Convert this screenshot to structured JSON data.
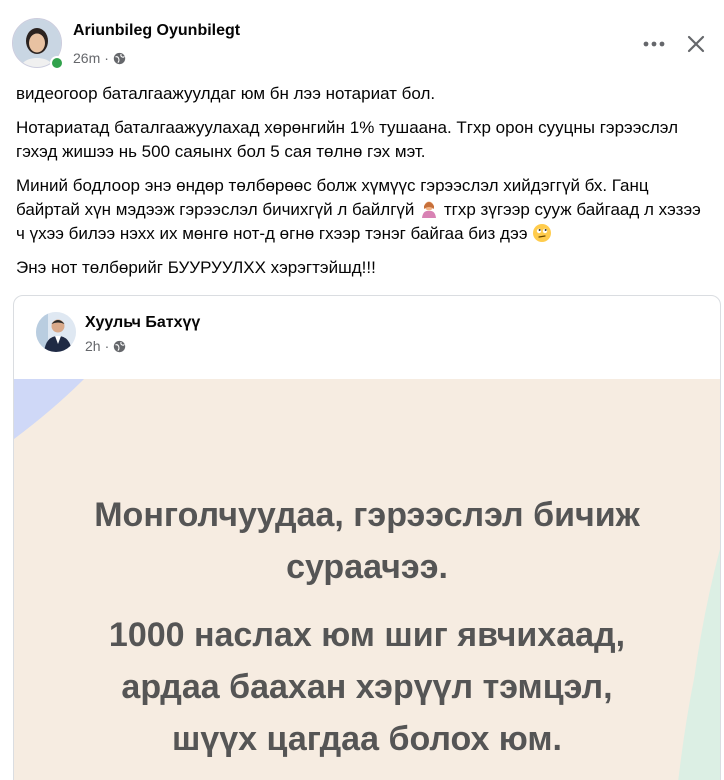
{
  "post": {
    "author": "Ariunbileg Oyunbilegt",
    "time": "26m",
    "visibility_icon": "globe-icon",
    "paragraphs": [
      "видеогоор баталгаажуулдаг юм бн лээ нотариат бол.",
      "Нотариатад баталгаажуулахад хөрөнгийн 1% тушаана. Тгхр орон сууцны гэрээслэл гэхэд жишээ нь 500 саяынх бол 5 сая төлнө гэх мэт.",
      "Миний бодлоор энэ өндөр төлбөрөөс болж хүмүүс гэрээслэл хийдэггүй бх. Ганц байртай хүн мэдээж гэрээслэл бичихгүй л байлгүй",
      "тгхр зүгээр сууж байгаад л хэзээ ч үхээ билээ нэхх их мөнгө нот-д өгнө гхээр тэнэг байгаа биз дээ",
      "Энэ нот төлбөрийг БУУРУУЛХХ хэрэгтэйшд!!!"
    ]
  },
  "shared_post": {
    "author": "Хуульч Батхүү",
    "time": "2h",
    "image_lines": [
      "Монголчуудаа, гэрээслэл бичиж",
      "сураачээ.",
      "1000 наслах юм шиг явчихаад,",
      "ардаа баахан хэрүүл тэмцэл,",
      "шүүх цагдаа болох юм."
    ]
  },
  "colors": {
    "online": "#31a24c",
    "image_bg": "#f6ece1",
    "image_text": "#555555",
    "accent_blue": "#cfd8f7",
    "accent_green": "#dcefe4"
  }
}
